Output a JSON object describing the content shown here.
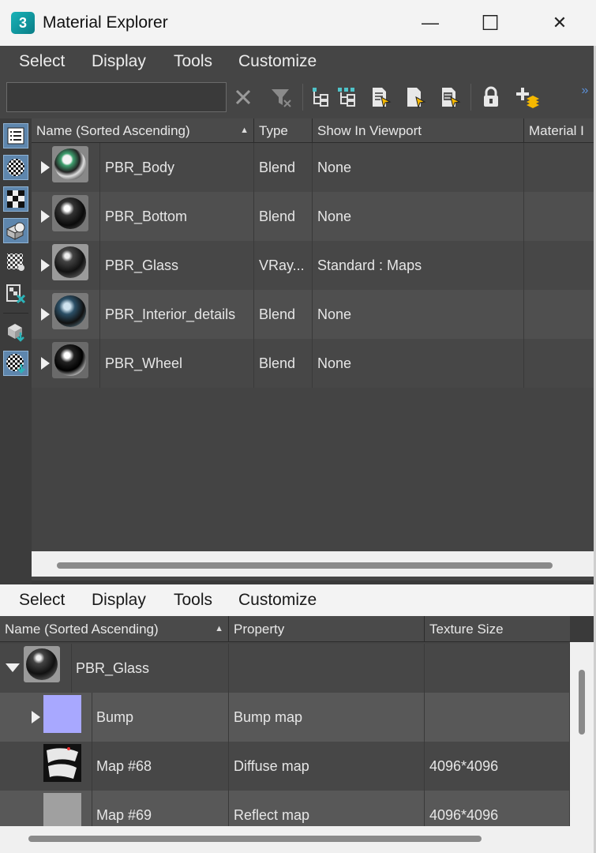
{
  "window": {
    "title": "Material Explorer",
    "app_icon_text": "3",
    "minimize_glyph": "—",
    "maximize_glyph": "☐",
    "close_glyph": "✕"
  },
  "menus": [
    "Select",
    "Display",
    "Tools",
    "Customize"
  ],
  "search": {
    "value": "",
    "placeholder": ""
  },
  "toolbar": {
    "overflow_glyph": "»"
  },
  "top_grid": {
    "columns": [
      "Name (Sorted Ascending)",
      "Type",
      "Show In Viewport",
      "Material I"
    ],
    "sort_glyph": "▲",
    "rows": [
      {
        "name": "PBR_Body",
        "type": "Blend",
        "viewport": "None"
      },
      {
        "name": "PBR_Bottom",
        "type": "Blend",
        "viewport": "None"
      },
      {
        "name": "PBR_Glass",
        "type": "VRay...",
        "viewport": "Standard : Maps"
      },
      {
        "name": "PBR_Interior_details",
        "type": "Blend",
        "viewport": "None"
      },
      {
        "name": "PBR_Wheel",
        "type": "Blend",
        "viewport": "None"
      }
    ]
  },
  "bottom_grid": {
    "columns": [
      "Name (Sorted Ascending)",
      "Property",
      "Texture Size"
    ],
    "sort_glyph": "▲",
    "parent": {
      "name": "PBR_Glass",
      "property": "",
      "size": ""
    },
    "rows": [
      {
        "name": "Bump",
        "property": "Bump map",
        "size": ""
      },
      {
        "name": "Map #68",
        "property": "Diffuse map",
        "size": "4096*4096"
      },
      {
        "name": "Map #69",
        "property": "Reflect map",
        "size": "4096*4096"
      }
    ]
  },
  "colors": {
    "accent": "#5e86ad",
    "panel": "#444444",
    "bump_swatch": "#a8a8ff"
  }
}
